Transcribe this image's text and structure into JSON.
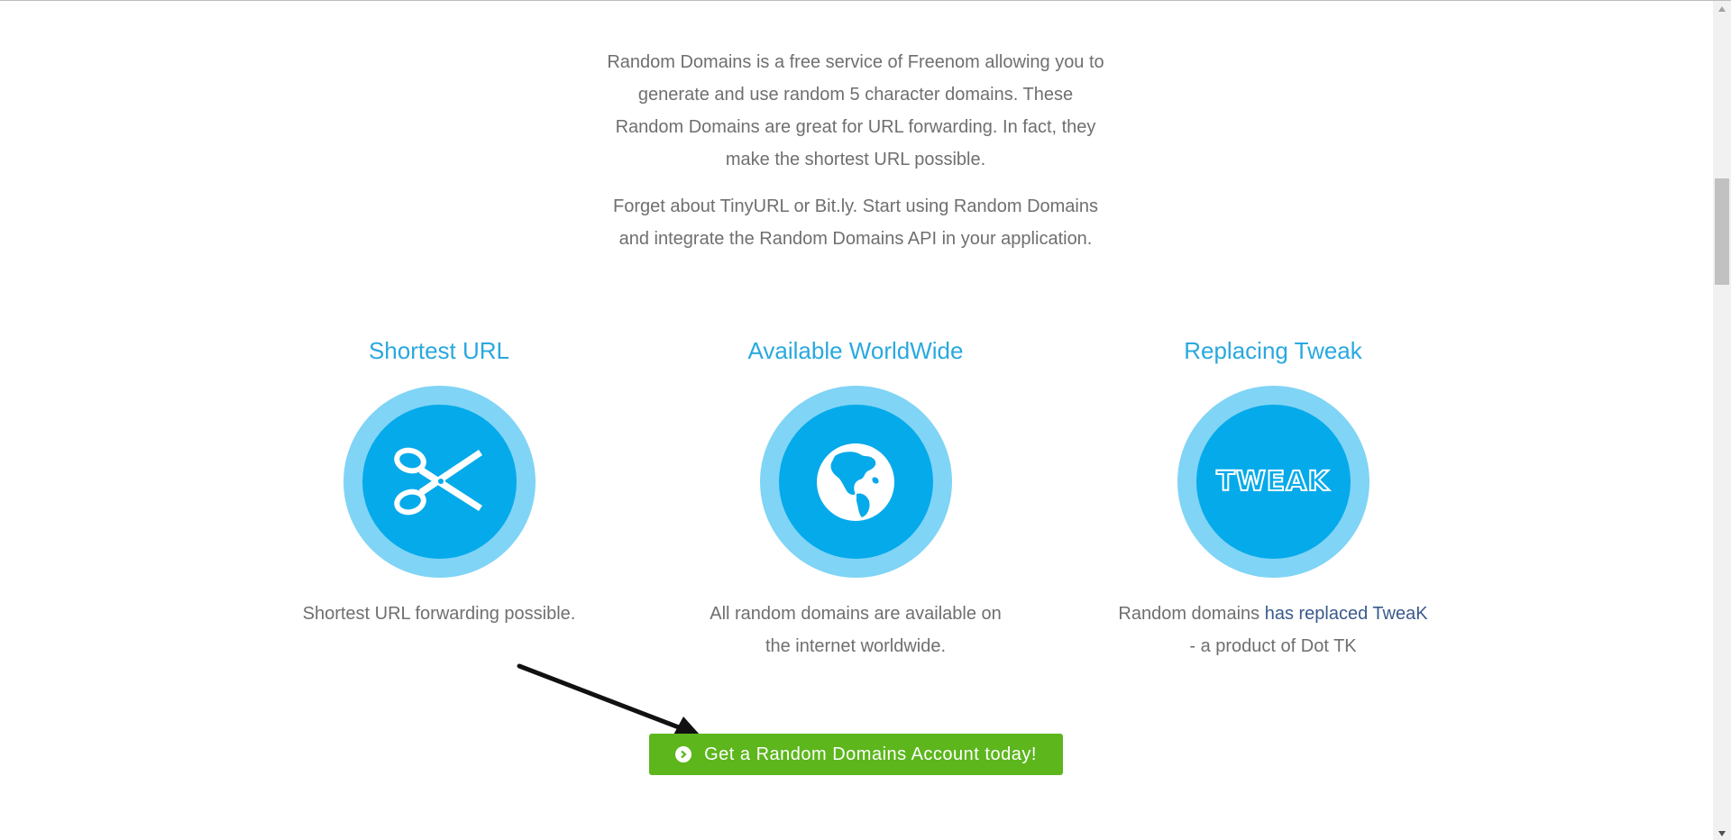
{
  "intro": {
    "paragraph1_lines": [
      "Random Domains is a free service of Freenom allowing you to",
      "generate and use random 5 character domains. These",
      "Random Domains are great for URL forwarding. In fact, they",
      "make the shortest URL possible."
    ],
    "paragraph2_lines": [
      "Forget about TinyURL or Bit.ly. Start using Random Domains",
      "and integrate the Random Domains API in your application."
    ]
  },
  "features": [
    {
      "title": "Shortest URL",
      "icon": "scissors-icon",
      "desc_lines": [
        "Shortest URL forwarding possible."
      ]
    },
    {
      "title": "Available WorldWide",
      "icon": "globe-icon",
      "desc_lines": [
        "All random domains are available on",
        "the internet worldwide."
      ]
    },
    {
      "title": "Replacing Tweak",
      "icon": "tweak-logo",
      "logo_text": "TWEAK",
      "desc_prefix": "Random domains ",
      "desc_link": "has replaced TweaK",
      "desc_line2": "- a product of Dot TK"
    }
  ],
  "cta": {
    "label": "Get a Random Domains Account today!",
    "icon": "chevron-circle-right-icon"
  },
  "colors": {
    "accent": "#29a8df",
    "circle_outer": "#80d4f6",
    "circle_inner": "#05aaea",
    "button": "#5cb61c",
    "text": "#6f6f6f"
  }
}
